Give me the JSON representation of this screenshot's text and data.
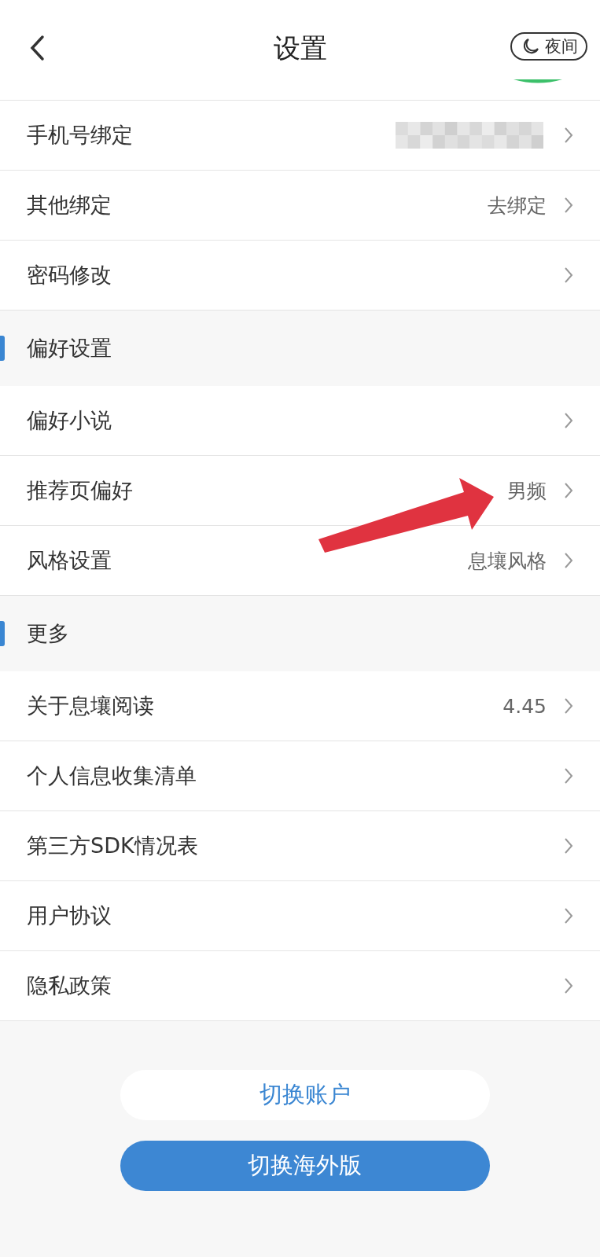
{
  "header": {
    "title": "设置",
    "night_label": "夜间"
  },
  "groups": [
    {
      "items": [
        {
          "label": "手机号绑定",
          "masked": true
        },
        {
          "label": "其他绑定",
          "value": "去绑定",
          "masked": false
        },
        {
          "label": "密码修改",
          "masked": false
        }
      ]
    },
    {
      "title": "偏好设置",
      "items": [
        {
          "label": "偏好小说",
          "masked": false
        },
        {
          "label": "推荐页偏好",
          "value": "男频",
          "masked": false
        },
        {
          "label": "风格设置",
          "value": "息壤风格",
          "masked": false
        }
      ]
    },
    {
      "title": "更多",
      "items": [
        {
          "label": "关于息壤阅读",
          "value": "4.45",
          "masked": false
        },
        {
          "label": "个人信息收集清单",
          "masked": false
        },
        {
          "label": "第三方SDK情况表",
          "masked": false
        },
        {
          "label": "用户协议",
          "masked": false
        },
        {
          "label": "隐私政策",
          "masked": false
        }
      ]
    }
  ],
  "buttons": [
    {
      "label": "切换账户",
      "kind": "secondary"
    },
    {
      "label": "切换海外版",
      "kind": "primary"
    }
  ]
}
